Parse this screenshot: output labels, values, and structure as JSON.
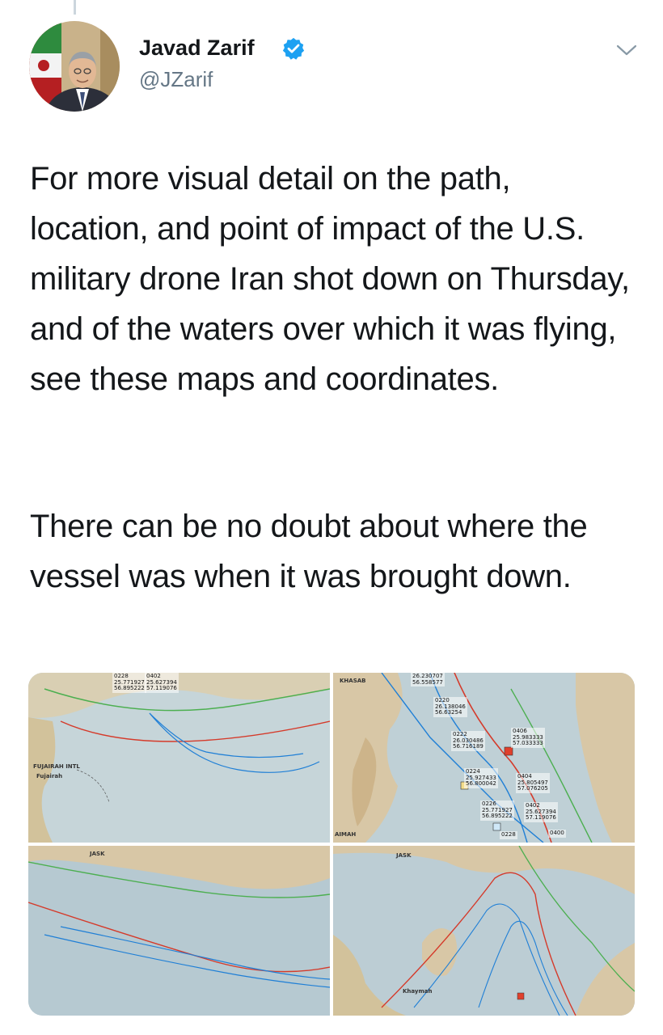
{
  "tweet": {
    "author_name": "Javad Zarif",
    "author_handle": "@JZarif",
    "paragraphs": [
      "For more visual detail on the path, location, and point of impact of the U.S. military drone Iran shot down on Thursday, and of the waters over which it was flying, see these maps and coordinates.",
      "There can be no doubt about where the vessel was when it was brought down."
    ]
  },
  "icons": {
    "verified": "verified-badge-icon",
    "menu": "chevron-down-icon",
    "avatar": "profile-photo"
  },
  "colors": {
    "verified": "#1da1f2",
    "handle": "#657786",
    "text": "#14171a",
    "map_sea": "#b9cbd3",
    "map_land": "#d8c7a6",
    "track_blue": "#1f7fd6",
    "border_red": "#d53a2a",
    "border_green": "#4caf50"
  },
  "media": {
    "tile_top_right": {
      "places": [
        "KHASAB",
        "AIMAH"
      ],
      "coords": [
        {
          "time": "0220",
          "lat": "26.138046",
          "lon": "56.63254"
        },
        {
          "time": "0222",
          "lat": "26.030486",
          "lon": "56.716189"
        },
        {
          "time": "0224",
          "lat": "25.927433",
          "lon": "56.800042"
        },
        {
          "time": "0226",
          "lat": "25.771927",
          "lon": "56.895222"
        },
        {
          "time": "0228",
          "lat": "",
          "lon": ""
        },
        {
          "time": "0402",
          "lat": "25.627394",
          "lon": "57.119076"
        },
        {
          "time": "0404",
          "lat": "25.805497",
          "lon": "57.076205"
        },
        {
          "time": "0406",
          "lat": "25.983333",
          "lon": "57.033333"
        },
        {
          "time": "0400",
          "lat": "",
          "lon": ""
        }
      ],
      "header_coord": {
        "lat": "26.230707",
        "lon": "56.558577"
      }
    },
    "tile_top_left": {
      "places": [
        "FUJAIRAH INTL",
        "Fujairah"
      ],
      "top_coords": [
        {
          "time": "0228",
          "lat": "25.771927",
          "lon": "56.895222"
        },
        {
          "time": "0402",
          "lat": "25.627394",
          "lon": "57.119076"
        }
      ]
    },
    "tile_bottom_left": {
      "places": [
        "JASK"
      ]
    },
    "tile_bottom_right": {
      "places": [
        "JASK",
        "Khaymah"
      ]
    }
  }
}
